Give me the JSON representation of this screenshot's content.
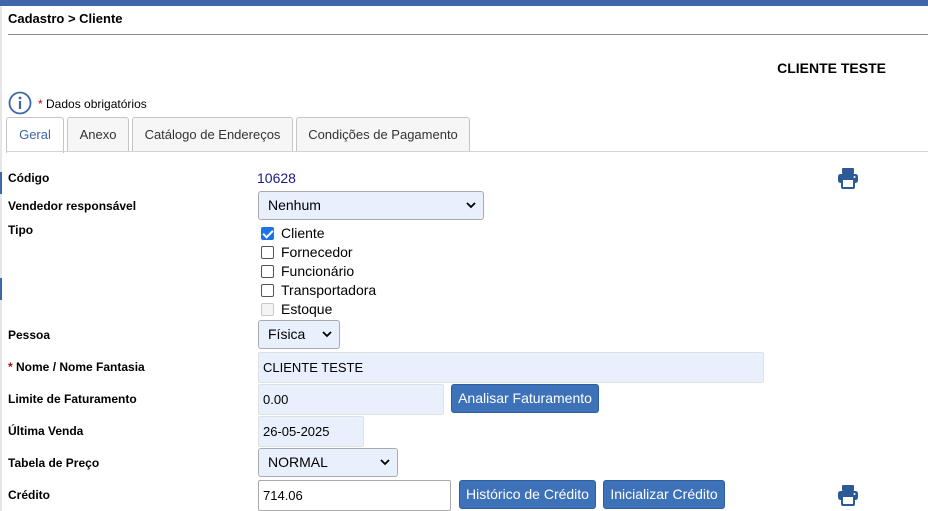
{
  "breadcrumb": "Cadastro > Cliente",
  "client_title": "CLIENTE TESTE",
  "required_note": {
    "star": "*",
    "text": "Dados obrigatórios"
  },
  "tabs": [
    {
      "label": "Geral",
      "active": true
    },
    {
      "label": "Anexo",
      "active": false
    },
    {
      "label": "Catálogo de Endereços",
      "active": false
    },
    {
      "label": "Condições de Pagamento",
      "active": false
    }
  ],
  "fields": {
    "codigo": {
      "label": "Código",
      "value": "10628"
    },
    "vendedor": {
      "label": "Vendedor responsável",
      "value": "Nenhum"
    },
    "tipo": {
      "label": "Tipo",
      "options": [
        {
          "label": "Cliente",
          "checked": true,
          "disabled": false
        },
        {
          "label": "Fornecedor",
          "checked": false,
          "disabled": false
        },
        {
          "label": "Funcionário",
          "checked": false,
          "disabled": false
        },
        {
          "label": "Transportadora",
          "checked": false,
          "disabled": false
        },
        {
          "label": "Estoque",
          "checked": false,
          "disabled": true
        }
      ]
    },
    "pessoa": {
      "label": "Pessoa",
      "value": "Física"
    },
    "nome": {
      "star": "*",
      "label": "Nome / Nome Fantasia",
      "value": "CLIENTE TESTE"
    },
    "limite": {
      "label": "Limite de Faturamento",
      "value": "0.00",
      "button": "Analisar Faturamento"
    },
    "ultima_venda": {
      "label": "Última Venda",
      "value": "26-05-2025"
    },
    "tabela_preco": {
      "label": "Tabela de Preço",
      "value": "NORMAL"
    },
    "credito": {
      "label": "Crédito",
      "value": "714.06",
      "button_historico": "Histórico de Crédito",
      "button_inicializar": "Inicializar Crédito"
    }
  },
  "colors": {
    "accent": "#3e66a8",
    "button": "#3e72b8",
    "required": "#cc0000",
    "input_bg": "#e8f0fe"
  }
}
